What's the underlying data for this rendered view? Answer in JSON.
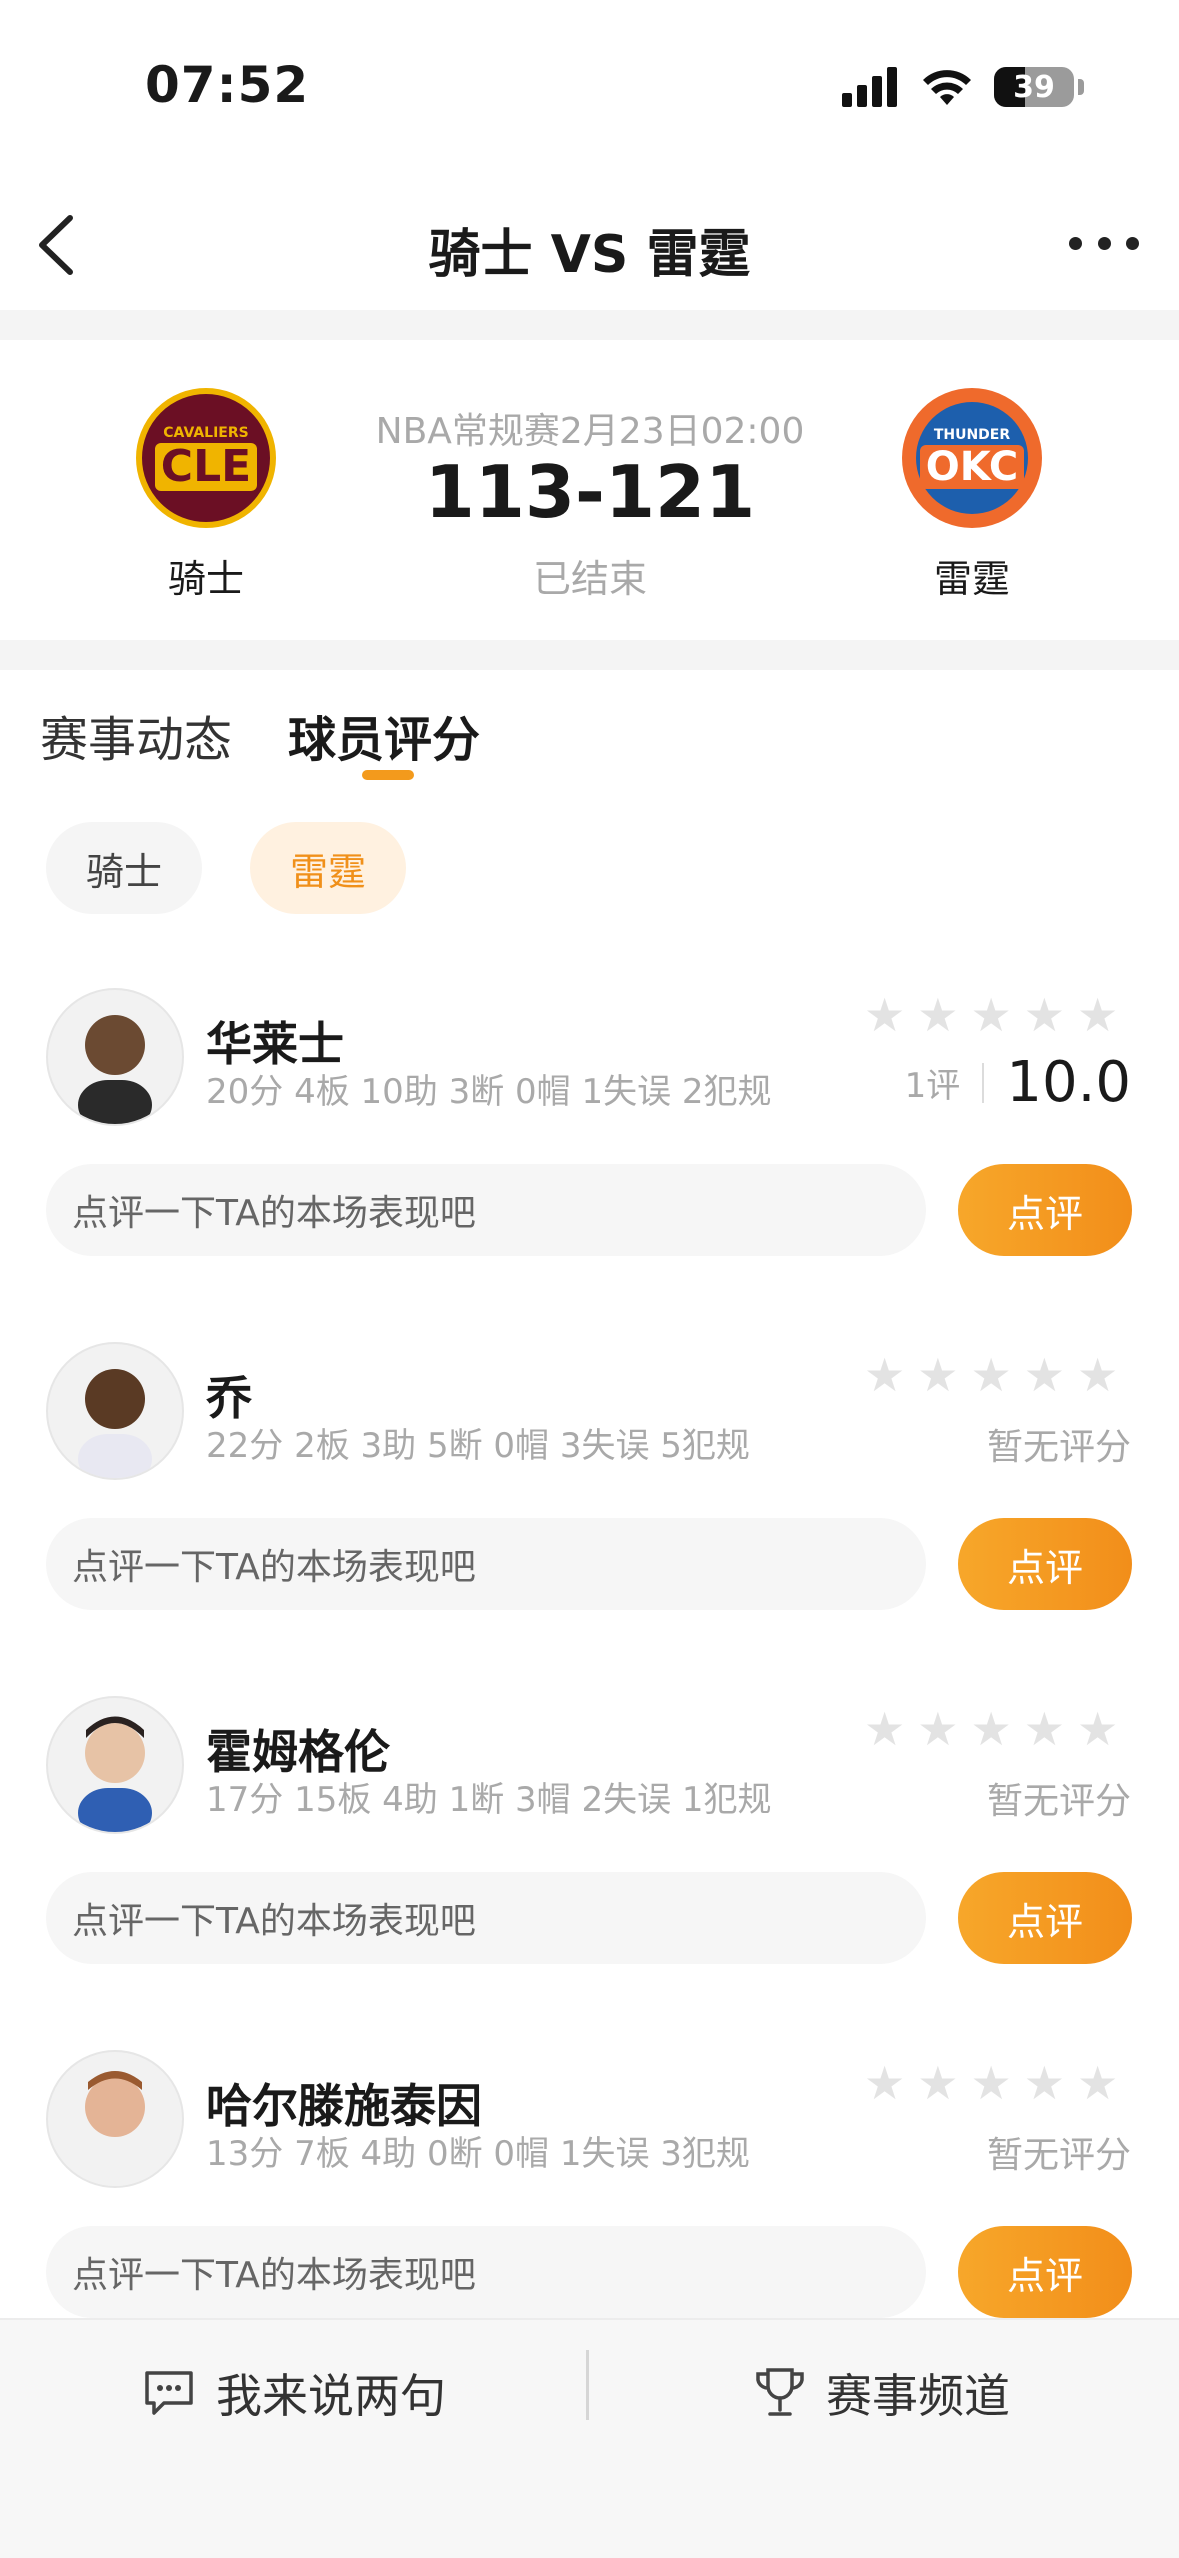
{
  "status_bar": {
    "time": "07:52",
    "battery": "39",
    "battery_level": 0.39
  },
  "nav": {
    "title": "骑士 VS 雷霆"
  },
  "match": {
    "meta": "NBA常规赛2月23日02:00",
    "score": "113-121",
    "status": "已结束",
    "home_team": "骑士",
    "away_team": "雷霆",
    "home_logo_top": "CAVALIERS",
    "home_logo_main": "CLE",
    "away_logo_top": "THUNDER",
    "away_logo_main": "OKC"
  },
  "tabs": [
    {
      "label": "赛事动态",
      "active": false
    },
    {
      "label": "球员评分",
      "active": true
    }
  ],
  "team_filter": [
    {
      "label": "骑士",
      "active": false
    },
    {
      "label": "雷霆",
      "active": true
    }
  ],
  "players": [
    {
      "name": "华莱士",
      "stats": "20分 4板 10助 3断 0帽 1失误 2犯规",
      "rating_count": "1评",
      "rating": "10.0",
      "stars_filled": 0
    },
    {
      "name": "乔",
      "stats": "22分 2板 3助 5断 0帽 3失误 5犯规",
      "no_rating": "暂无评分",
      "stars_filled": 0
    },
    {
      "name": "霍姆格伦",
      "stats": "17分 15板 4助 1断 3帽 2失误 1犯规",
      "no_rating": "暂无评分",
      "stars_filled": 0
    },
    {
      "name": "哈尔滕施泰因",
      "stats": "13分 7板 4助 0断 0帽 1失误 3犯规",
      "no_rating": "暂无评分",
      "stars_filled": 0
    }
  ],
  "comment": {
    "placeholder": "点评一下TA的本场表现吧",
    "button": "点评"
  },
  "bottom_bar": {
    "left_label": "我来说两句",
    "right_label": "赛事频道"
  },
  "colors": {
    "accent": "#f39a1c",
    "chip_active_bg": "#fff1e0",
    "star_empty": "#e3e3e3"
  }
}
